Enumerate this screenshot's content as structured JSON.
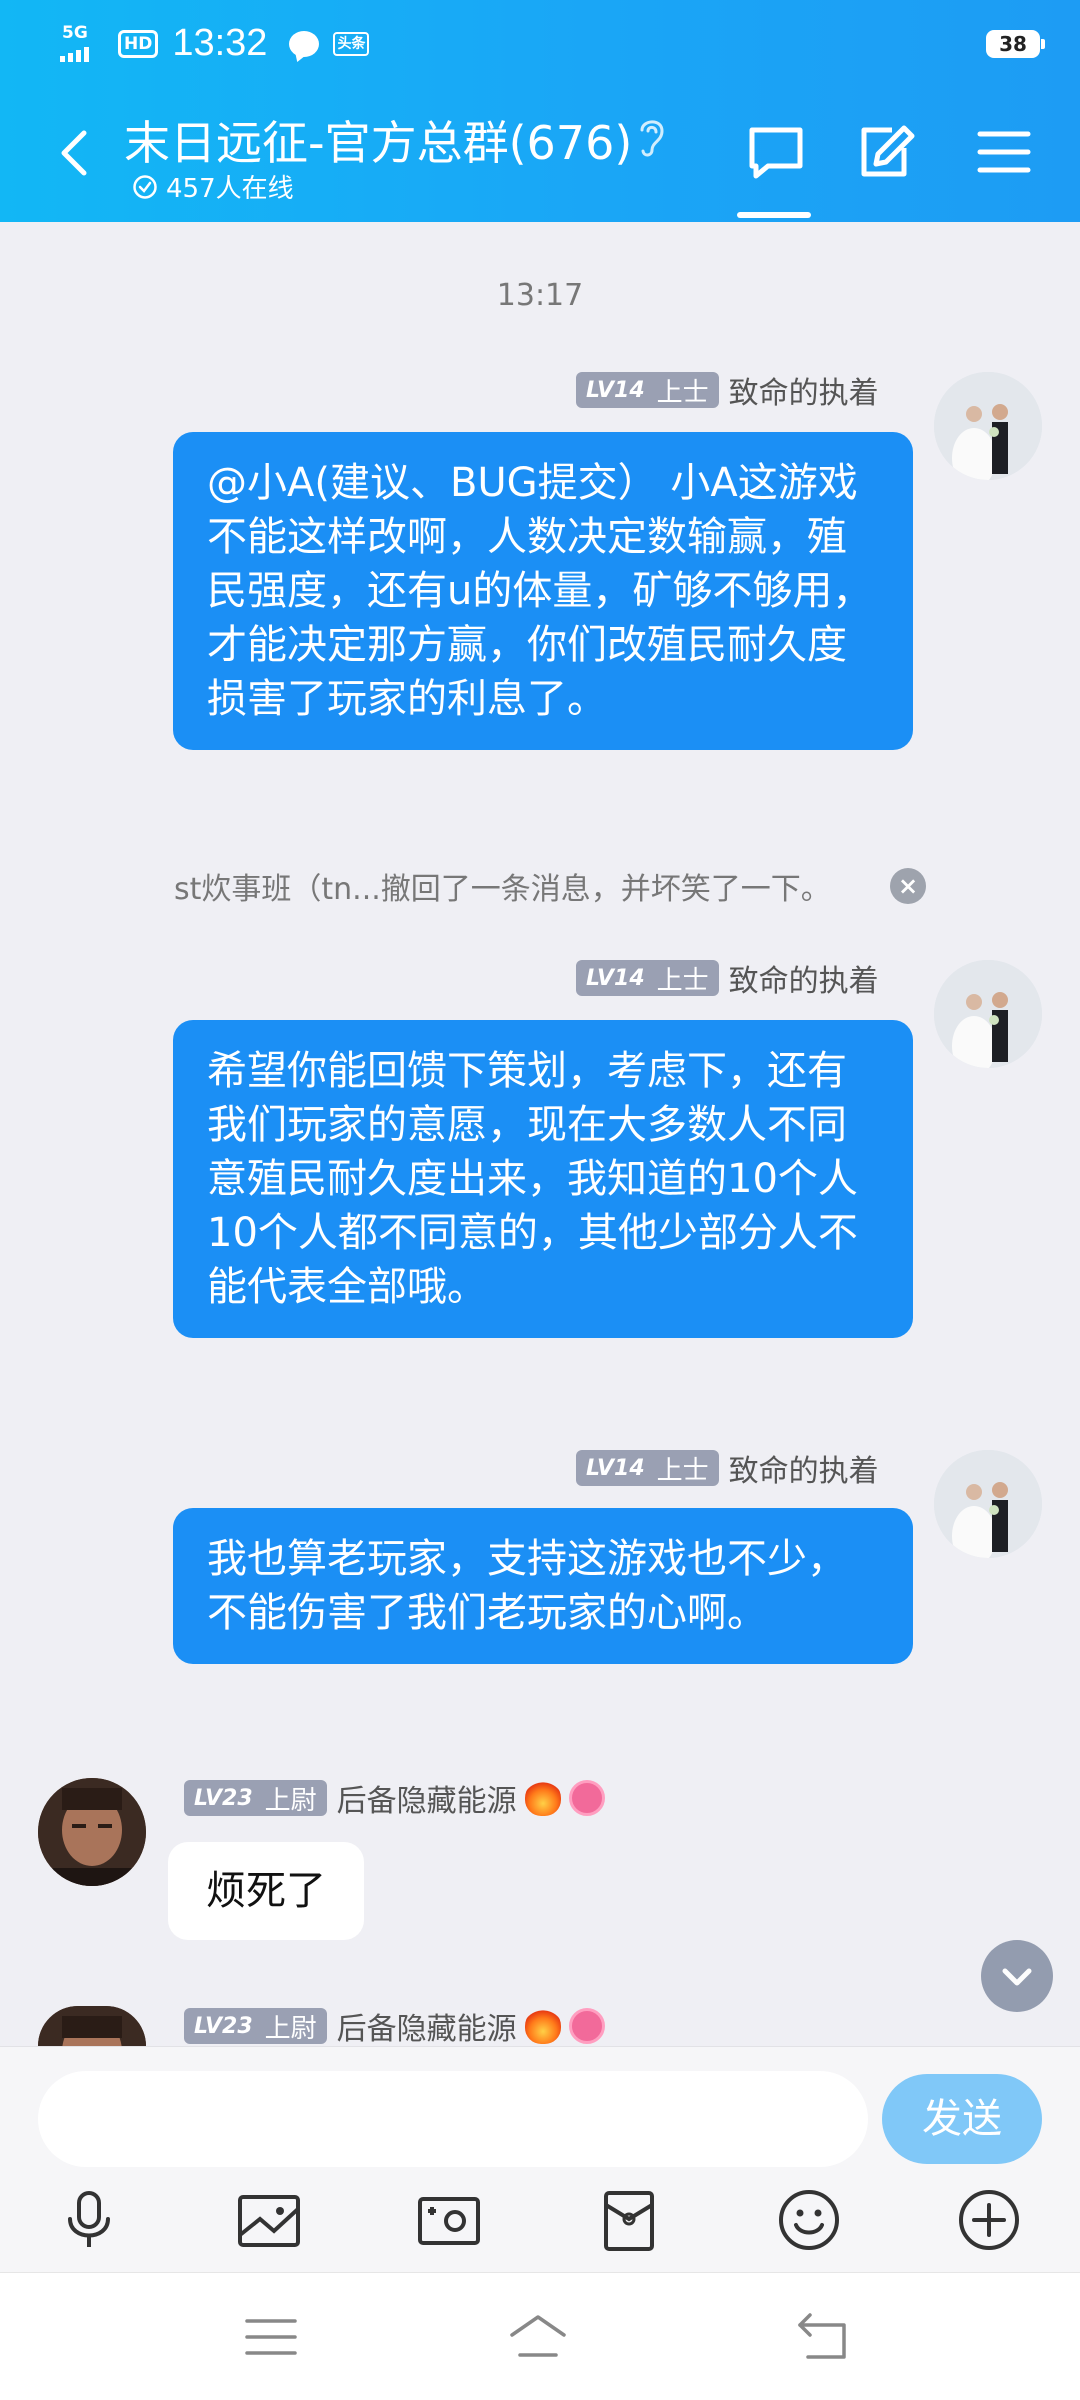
{
  "status_bar": {
    "network": "5G",
    "hd": "HD",
    "time": "13:32",
    "toutiao": "头条",
    "battery": "38"
  },
  "header": {
    "back_icon": "back-arrow-icon",
    "title": "末日远征-官方总群(676)",
    "online": "457人在线",
    "ear_icon": "ear-icon",
    "chat_tab_icon": "chat-bubble-icon",
    "edit_icon": "edit-icon",
    "menu_icon": "menu-icon",
    "accent": "#12b7f5"
  },
  "chat": {
    "time_divider": "13:17",
    "messages": [
      {
        "side": "right",
        "level": "LV14",
        "rank": "上士",
        "sender": "致命的执着",
        "text": "@小A(建议、BUG提交） 小A这游戏不能这样改啊，人数决定数输赢，殖民强度，还有u的体量，矿够不够用，才能决定那方赢，你们改殖民耐久度损害了玩家的利息了。"
      },
      {
        "side": "right",
        "level": "LV14",
        "rank": "上士",
        "sender": "致命的执着",
        "text": "希望你能回馈下策划，考虑下，还有我们玩家的意愿，现在大多数人不同意殖民耐久度出来，我知道的10个人10个人都不同意的，其他少部分人不能代表全部哦。"
      },
      {
        "side": "right",
        "level": "LV14",
        "rank": "上士",
        "sender": "致命的执着",
        "text": "我也算老玩家，支持这游戏也不少，不能伤害了我们老玩家的心啊。"
      },
      {
        "side": "left",
        "level": "LV23",
        "rank": "上尉",
        "sender": "后备隐藏能源",
        "text": "烦死了"
      },
      {
        "side": "left",
        "level": "LV23",
        "rank": "上尉",
        "sender": "后备隐藏能源",
        "text": ""
      }
    ],
    "recall_notice": "st炊事班（tn...撤回了一条消息，并坏笑了一下。",
    "recall_close": "×",
    "user_bubble_color": "#1b8ff5"
  },
  "input": {
    "placeholder": "",
    "send_label": "发送",
    "tools": [
      "microphone-icon",
      "image-icon",
      "camera-icon",
      "red-packet-icon",
      "emoji-icon",
      "plus-icon"
    ]
  },
  "nav": {
    "items": [
      "menu-icon",
      "home-icon",
      "back-icon"
    ]
  }
}
